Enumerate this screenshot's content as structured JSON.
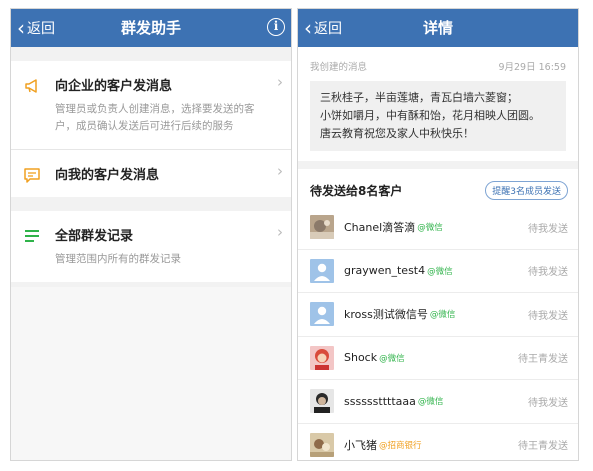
{
  "left": {
    "back_label": "返回",
    "title": "群发助手",
    "info_icon": "info-icon",
    "menu": [
      {
        "icon": "megaphone-icon",
        "title": "向企业的客户发消息",
        "desc_lines": [
          "管理员或负责人创建消息，选择要发送的客",
          "户，成员确认发送后可进行后续的服务"
        ]
      },
      {
        "icon": "message-icon",
        "title": "向我的客户发消息",
        "desc_lines": []
      }
    ],
    "records": {
      "icon": "list-icon",
      "title": "全部群发记录",
      "desc": "管理范围内所有的群发记录"
    }
  },
  "right": {
    "back_label": "返回",
    "title": "详情",
    "created_label": "我创建的消息",
    "datetime": "9月29日 16:59",
    "message_lines": [
      "三秋桂子，半亩莲塘，青瓦白墙六菱窗；",
      "小饼如嚼月，中有酥和饴，花月相映人团圆。",
      "唐云教育祝您及家人中秋快乐！"
    ],
    "pending_title": "待发送给8名客户",
    "remind_label": "提醒3名成员发送",
    "customers": [
      {
        "name": "Chanel滴答滴",
        "tag": "@微信",
        "tag_color": "#2fb34a",
        "status": "待我发送",
        "avatar": "photo-avatar"
      },
      {
        "name": "graywen_test4",
        "tag": "@微信",
        "tag_color": "#2fb34a",
        "status": "待我发送",
        "avatar": "default-avatar"
      },
      {
        "name": "kross测试微信号",
        "tag": "@微信",
        "tag_color": "#2fb34a",
        "status": "待我发送",
        "avatar": "default-avatar"
      },
      {
        "name": "Shock",
        "tag": "@微信",
        "tag_color": "#2fb34a",
        "status": "待王青发送",
        "avatar": "photo-avatar"
      },
      {
        "name": "ssssssttttaaa",
        "tag": "@微信",
        "tag_color": "#2fb34a",
        "status": "待我发送",
        "avatar": "photo-avatar"
      },
      {
        "name": "小飞猪",
        "tag": "@招商银行",
        "tag_color": "#f0a020",
        "status": "待王青发送",
        "avatar": "photo-avatar"
      }
    ]
  },
  "colors": {
    "navbar": "#3d72b3",
    "wechat_green": "#2fb34a",
    "bank_orange": "#f0a020"
  }
}
